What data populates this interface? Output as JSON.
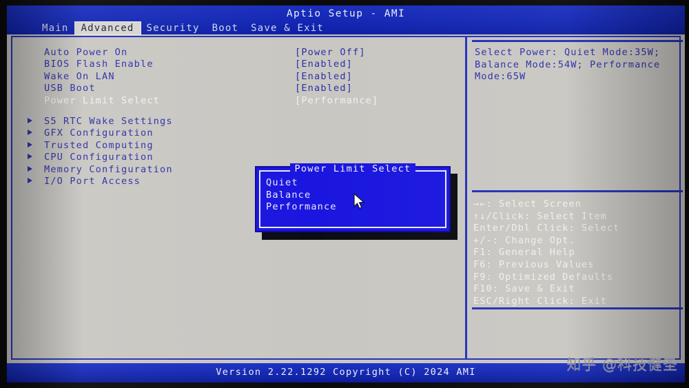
{
  "app": {
    "title": "Aptio Setup - AMI",
    "footer": "Version 2.22.1292 Copyright (C) 2024 AMI"
  },
  "menubar": {
    "tabs": [
      {
        "label": "Main",
        "active": false
      },
      {
        "label": "Advanced",
        "active": true
      },
      {
        "label": "Security",
        "active": false
      },
      {
        "label": "Boot",
        "active": false
      },
      {
        "label": "Save & Exit",
        "active": false
      }
    ]
  },
  "settings": {
    "rows": [
      {
        "label": "Auto Power On",
        "value": "[Power Off]",
        "selected": false,
        "submenu": false
      },
      {
        "label": "BIOS Flash Enable",
        "value": "[Enabled]",
        "selected": false,
        "submenu": false
      },
      {
        "label": "Wake On LAN",
        "value": "[Enabled]",
        "selected": false,
        "submenu": false
      },
      {
        "label": "USB Boot",
        "value": "[Enabled]",
        "selected": false,
        "submenu": false
      },
      {
        "label": "Power Limit Select",
        "value": "[Performance]",
        "selected": true,
        "submenu": false
      }
    ],
    "submenus": [
      {
        "label": "S5 RTC Wake Settings",
        "submenu": true
      },
      {
        "label": "GFX Configuration",
        "submenu": true
      },
      {
        "label": "Trusted Computing",
        "submenu": true
      },
      {
        "label": "CPU Configuration",
        "submenu": true
      },
      {
        "label": "Memory Configuration",
        "submenu": true
      },
      {
        "label": "I/O Port Access",
        "submenu": true
      }
    ]
  },
  "help": {
    "text": "Select Power: Quiet Mode:35W; Balance Mode:54W; Performance Mode:65W",
    "legend": [
      "→←: Select Screen",
      "↑↓/Click: Select Item",
      "Enter/Dbl Click: Select",
      "+/-: Change Opt.",
      "F1: General Help",
      "F6: Previous Values",
      "F9: Optimized Defaults",
      "F10: Save & Exit",
      "ESC/Right Click: Exit"
    ]
  },
  "popup": {
    "title": "Power Limit Select",
    "options": [
      {
        "label": "Quiet",
        "highlighted": false
      },
      {
        "label": "Balance",
        "highlighted": false
      },
      {
        "label": "Performance",
        "highlighted": true
      }
    ]
  },
  "overlay": {
    "watermark": "知乎 @科技健圣"
  },
  "colors": {
    "screen_blue": "#1226ae",
    "panel_gray": "#c9c7c2",
    "label_blue": "#2c2fa8",
    "selected_white": "#f2f2f0",
    "popup_blue": "#1a16df",
    "highlight_black": "#08060c"
  }
}
